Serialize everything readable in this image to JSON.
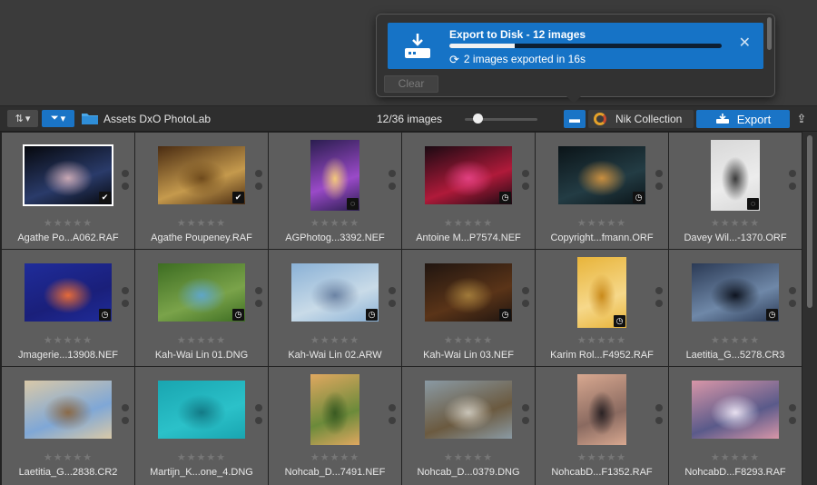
{
  "popup": {
    "job_title": "Export to Disk - 12 images",
    "progress": 0.24,
    "status": "2 images exported in 16s",
    "close_glyph": "✕",
    "clear_label": "Clear"
  },
  "toolbar": {
    "folder_name": "Assets DxO PhotoLab",
    "count": "12/36 images",
    "zoom": 0.12,
    "nik_label": "Nik Collection",
    "export_label": "Export"
  },
  "images": [
    {
      "name": "Agathe Po...A062.RAF",
      "badge": "check",
      "colors": [
        "#06080d",
        "#2a3b6a",
        "#c8a8b4"
      ],
      "selected": true,
      "orient": "landscape"
    },
    {
      "name": "Agathe Poupeney.RAF",
      "badge": "check",
      "colors": [
        "#4a2c12",
        "#c59a4d",
        "#6e4a1c"
      ],
      "selected": false,
      "orient": "landscape"
    },
    {
      "name": "AGPhotog...3392.NEF",
      "badge": "pending",
      "colors": [
        "#2a1d4f",
        "#9a4ac8",
        "#f3c87b"
      ],
      "selected": false,
      "orient": "portrait"
    },
    {
      "name": "Antoine M...P7574.NEF",
      "badge": "clock",
      "colors": [
        "#1a0a12",
        "#b01a3a",
        "#e04080"
      ],
      "selected": false,
      "orient": "landscape"
    },
    {
      "name": "Copyright...fmann.ORF",
      "badge": "clock",
      "colors": [
        "#0b1418",
        "#233c44",
        "#c98f40"
      ],
      "selected": false,
      "orient": "landscape"
    },
    {
      "name": "Davey Wil...-1370.ORF",
      "badge": "pending",
      "colors": [
        "#d8d8d8",
        "#ececec",
        "#3b3b3b"
      ],
      "selected": false,
      "orient": "portrait"
    },
    {
      "name": "Jmagerie...13908.NEF",
      "badge": "clock",
      "colors": [
        "#1f2c9a",
        "#1a1f7a",
        "#e56a3a"
      ],
      "selected": false,
      "orient": "landscape"
    },
    {
      "name": "Kah-Wai Lin 01.DNG",
      "badge": "clock",
      "colors": [
        "#3d6d22",
        "#7aa34a",
        "#5fa6c8"
      ],
      "selected": false,
      "orient": "landscape"
    },
    {
      "name": "Kah-Wai Lin 02.ARW",
      "badge": "clock",
      "colors": [
        "#8ab1d6",
        "#c9dbe8",
        "#6b83a4"
      ],
      "selected": false,
      "orient": "landscape"
    },
    {
      "name": "Kah-Wai Lin 03.NEF",
      "badge": "clock",
      "colors": [
        "#201510",
        "#5a3418",
        "#a07a3a"
      ],
      "selected": false,
      "orient": "landscape"
    },
    {
      "name": "Karim Rol...F4952.RAF",
      "badge": "clock",
      "colors": [
        "#e8b43a",
        "#f6d88a",
        "#c98a1a"
      ],
      "selected": false,
      "orient": "portrait"
    },
    {
      "name": "Laetitia_G...5278.CR3",
      "badge": "clock",
      "colors": [
        "#2b3a55",
        "#6f88a8",
        "#0e1420"
      ],
      "selected": false,
      "orient": "landscape"
    },
    {
      "name": "Laetitia_G...2838.CR2",
      "badge": "",
      "colors": [
        "#d9c9a8",
        "#7fa7d6",
        "#8a6a48"
      ],
      "selected": false,
      "orient": "landscape"
    },
    {
      "name": "Martijn_K...one_4.DNG",
      "badge": "",
      "colors": [
        "#19a5b0",
        "#2bc1c9",
        "#127a86"
      ],
      "selected": false,
      "orient": "landscape"
    },
    {
      "name": "Nohcab_D...7491.NEF",
      "badge": "",
      "colors": [
        "#e0a860",
        "#6b8a3a",
        "#3a5a22"
      ],
      "selected": false,
      "orient": "portrait"
    },
    {
      "name": "Nohcab_D...0379.DNG",
      "badge": "",
      "colors": [
        "#8a9aa4",
        "#6b5a40",
        "#c9c4b8"
      ],
      "selected": false,
      "orient": "landscape"
    },
    {
      "name": "NohcabD...F1352.RAF",
      "badge": "",
      "colors": [
        "#d8a890",
        "#8a6a60",
        "#2a2224"
      ],
      "selected": false,
      "orient": "portrait"
    },
    {
      "name": "NohcabD...F8293.RAF",
      "badge": "",
      "colors": [
        "#d896a8",
        "#5a5a8a",
        "#e8e0f0"
      ],
      "selected": false,
      "orient": "landscape"
    }
  ],
  "rating_glyphs": "★★★★★"
}
